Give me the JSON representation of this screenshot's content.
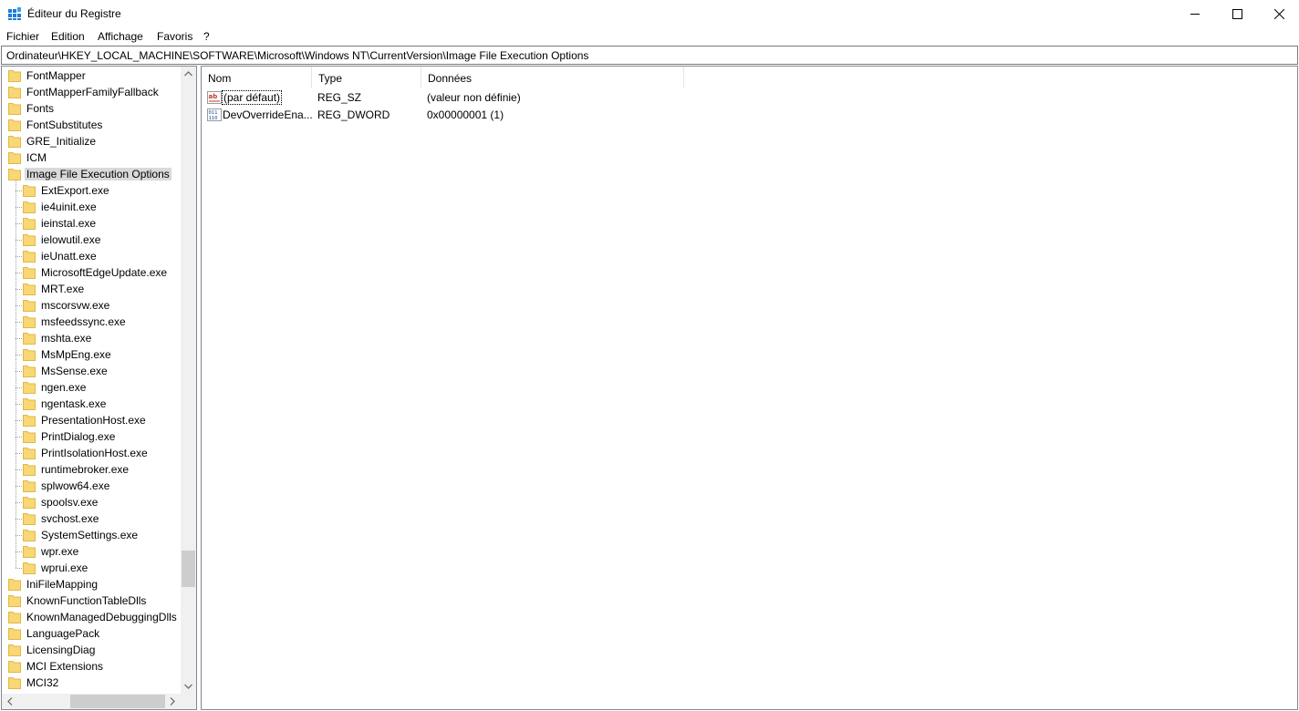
{
  "window": {
    "title": "Éditeur du Registre",
    "controls": [
      "minimize",
      "maximize",
      "close"
    ]
  },
  "menu": {
    "items": [
      {
        "label": "Fichier"
      },
      {
        "label": "Edition"
      },
      {
        "label": "Affichage"
      },
      {
        "label": "Favoris"
      },
      {
        "label": "?"
      }
    ]
  },
  "address": {
    "path": "Ordinateur\\HKEY_LOCAL_MACHINE\\SOFTWARE\\Microsoft\\Windows NT\\CurrentVersion\\Image File Execution Options"
  },
  "tree": {
    "top_items_before": [
      "FontMapper",
      "FontMapperFamilyFallback",
      "Fonts",
      "FontSubstitutes",
      "GRE_Initialize",
      "ICM"
    ],
    "selected": "Image File Execution Options",
    "children": [
      "ExtExport.exe",
      "ie4uinit.exe",
      "ieinstal.exe",
      "ielowutil.exe",
      "ieUnatt.exe",
      "MicrosoftEdgeUpdate.exe",
      "MRT.exe",
      "mscorsvw.exe",
      "msfeedssync.exe",
      "mshta.exe",
      "MsMpEng.exe",
      "MsSense.exe",
      "ngen.exe",
      "ngentask.exe",
      "PresentationHost.exe",
      "PrintDialog.exe",
      "PrintIsolationHost.exe",
      "runtimebroker.exe",
      "splwow64.exe",
      "spoolsv.exe",
      "svchost.exe",
      "SystemSettings.exe",
      "wpr.exe",
      "wprui.exe"
    ],
    "top_items_after": [
      "IniFileMapping",
      "KnownFunctionTableDlls",
      "KnownManagedDebuggingDlls",
      "LanguagePack",
      "LicensingDiag",
      "MCI Extensions",
      "MCI32"
    ],
    "folder_icon": "folder-icon"
  },
  "list": {
    "columns": [
      {
        "label": "Nom"
      },
      {
        "label": "Type"
      },
      {
        "label": "Données"
      }
    ],
    "rows": [
      {
        "icon": "string-value-icon",
        "name": "(par défaut)",
        "type": "REG_SZ",
        "data": "(valeur non définie)"
      },
      {
        "icon": "binary-value-icon",
        "name": "DevOverrideEna...",
        "type": "REG_DWORD",
        "data": "0x00000001 (1)"
      }
    ]
  },
  "colors": {
    "folder": "#f8d775",
    "folder_dark": "#e0b848",
    "selection": "#d9d9d9",
    "scrollbar_track": "#f0f0f0",
    "scrollbar_thumb": "#cdcdcd"
  }
}
